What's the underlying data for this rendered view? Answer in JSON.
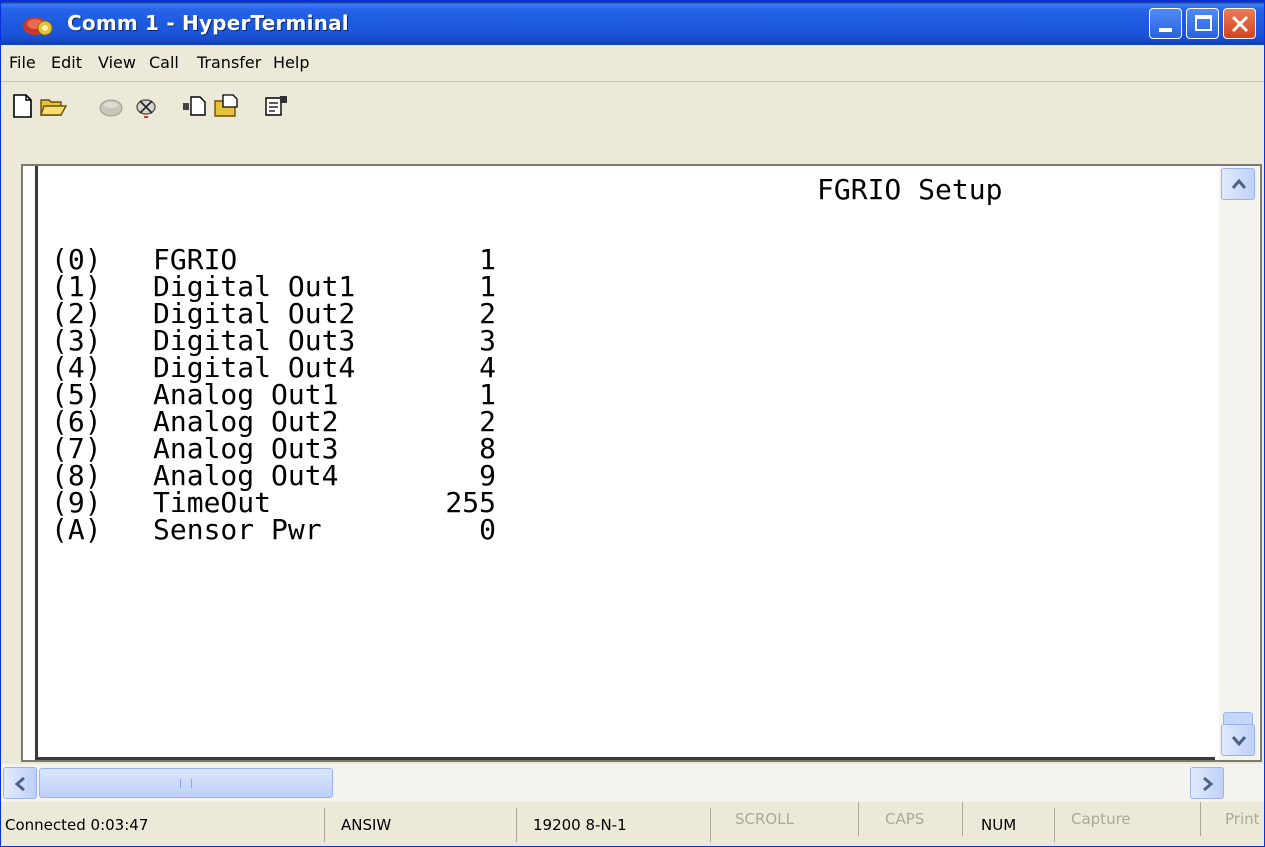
{
  "window": {
    "title": "Comm 1 - HyperTerminal",
    "icon": "phone-terminal-icon"
  },
  "menu": [
    "File",
    "Edit",
    "View",
    "Call",
    "Transfer",
    "Help"
  ],
  "toolbar": {
    "icons": [
      "new-file-icon",
      "open-folder-icon",
      "call-icon",
      "disconnect-icon",
      "send-icon",
      "receive-icon",
      "properties-icon"
    ]
  },
  "terminal": {
    "heading": "FGRIO Setup",
    "rows": [
      {
        "key": "(0)",
        "label": "FGRIO",
        "value": "1"
      },
      {
        "key": "(1)",
        "label": "Digital Out1",
        "value": "1"
      },
      {
        "key": "(2)",
        "label": "Digital Out2",
        "value": "2"
      },
      {
        "key": "(3)",
        "label": "Digital Out3",
        "value": "3"
      },
      {
        "key": "(4)",
        "label": "Digital Out4",
        "value": "4"
      },
      {
        "key": "(5)",
        "label": "Analog Out1",
        "value": "1"
      },
      {
        "key": "(6)",
        "label": "Analog Out2",
        "value": "2"
      },
      {
        "key": "(7)",
        "label": "Analog Out3",
        "value": "8"
      },
      {
        "key": "(8)",
        "label": "Analog Out4",
        "value": "9"
      },
      {
        "key": "(9)",
        "label": "TimeOut",
        "value": "255"
      },
      {
        "key": "(A)",
        "label": "Sensor Pwr",
        "value": "0"
      }
    ]
  },
  "status": {
    "connected": "Connected 0:03:47",
    "emulation": "ANSIW",
    "settings": "19200 8-N-1",
    "scroll": "SCROLL",
    "caps": "CAPS",
    "num": "NUM",
    "capture": "Capture",
    "print": "Print echo"
  },
  "colors": {
    "titlebar": "#1d5ae0",
    "close": "#d2431f",
    "chrome": "#ece9d8"
  }
}
